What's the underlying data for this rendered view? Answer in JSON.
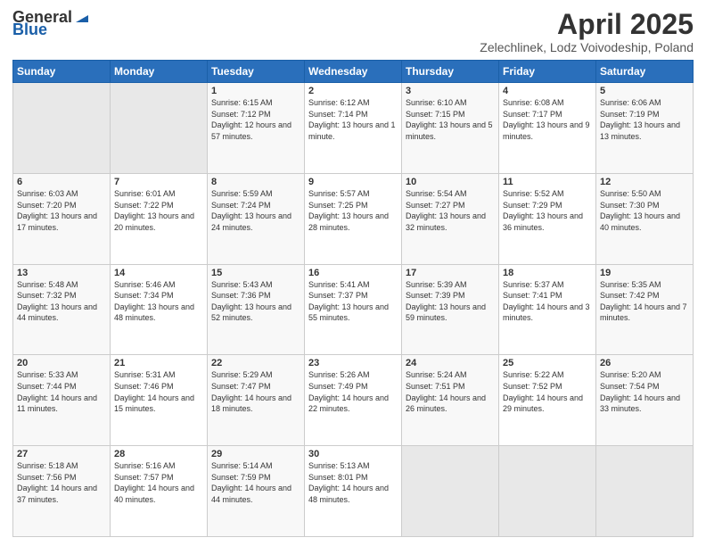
{
  "header": {
    "logo_general": "General",
    "logo_blue": "Blue",
    "month_title": "April 2025",
    "location": "Zelechlinek, Lodz Voivodeship, Poland"
  },
  "days_of_week": [
    "Sunday",
    "Monday",
    "Tuesday",
    "Wednesday",
    "Thursday",
    "Friday",
    "Saturday"
  ],
  "weeks": [
    [
      {
        "day": "",
        "sunrise": "",
        "sunset": "",
        "daylight": ""
      },
      {
        "day": "",
        "sunrise": "",
        "sunset": "",
        "daylight": ""
      },
      {
        "day": "1",
        "sunrise": "Sunrise: 6:15 AM",
        "sunset": "Sunset: 7:12 PM",
        "daylight": "Daylight: 12 hours and 57 minutes."
      },
      {
        "day": "2",
        "sunrise": "Sunrise: 6:12 AM",
        "sunset": "Sunset: 7:14 PM",
        "daylight": "Daylight: 13 hours and 1 minute."
      },
      {
        "day": "3",
        "sunrise": "Sunrise: 6:10 AM",
        "sunset": "Sunset: 7:15 PM",
        "daylight": "Daylight: 13 hours and 5 minutes."
      },
      {
        "day": "4",
        "sunrise": "Sunrise: 6:08 AM",
        "sunset": "Sunset: 7:17 PM",
        "daylight": "Daylight: 13 hours and 9 minutes."
      },
      {
        "day": "5",
        "sunrise": "Sunrise: 6:06 AM",
        "sunset": "Sunset: 7:19 PM",
        "daylight": "Daylight: 13 hours and 13 minutes."
      }
    ],
    [
      {
        "day": "6",
        "sunrise": "Sunrise: 6:03 AM",
        "sunset": "Sunset: 7:20 PM",
        "daylight": "Daylight: 13 hours and 17 minutes."
      },
      {
        "day": "7",
        "sunrise": "Sunrise: 6:01 AM",
        "sunset": "Sunset: 7:22 PM",
        "daylight": "Daylight: 13 hours and 20 minutes."
      },
      {
        "day": "8",
        "sunrise": "Sunrise: 5:59 AM",
        "sunset": "Sunset: 7:24 PM",
        "daylight": "Daylight: 13 hours and 24 minutes."
      },
      {
        "day": "9",
        "sunrise": "Sunrise: 5:57 AM",
        "sunset": "Sunset: 7:25 PM",
        "daylight": "Daylight: 13 hours and 28 minutes."
      },
      {
        "day": "10",
        "sunrise": "Sunrise: 5:54 AM",
        "sunset": "Sunset: 7:27 PM",
        "daylight": "Daylight: 13 hours and 32 minutes."
      },
      {
        "day": "11",
        "sunrise": "Sunrise: 5:52 AM",
        "sunset": "Sunset: 7:29 PM",
        "daylight": "Daylight: 13 hours and 36 minutes."
      },
      {
        "day": "12",
        "sunrise": "Sunrise: 5:50 AM",
        "sunset": "Sunset: 7:30 PM",
        "daylight": "Daylight: 13 hours and 40 minutes."
      }
    ],
    [
      {
        "day": "13",
        "sunrise": "Sunrise: 5:48 AM",
        "sunset": "Sunset: 7:32 PM",
        "daylight": "Daylight: 13 hours and 44 minutes."
      },
      {
        "day": "14",
        "sunrise": "Sunrise: 5:46 AM",
        "sunset": "Sunset: 7:34 PM",
        "daylight": "Daylight: 13 hours and 48 minutes."
      },
      {
        "day": "15",
        "sunrise": "Sunrise: 5:43 AM",
        "sunset": "Sunset: 7:36 PM",
        "daylight": "Daylight: 13 hours and 52 minutes."
      },
      {
        "day": "16",
        "sunrise": "Sunrise: 5:41 AM",
        "sunset": "Sunset: 7:37 PM",
        "daylight": "Daylight: 13 hours and 55 minutes."
      },
      {
        "day": "17",
        "sunrise": "Sunrise: 5:39 AM",
        "sunset": "Sunset: 7:39 PM",
        "daylight": "Daylight: 13 hours and 59 minutes."
      },
      {
        "day": "18",
        "sunrise": "Sunrise: 5:37 AM",
        "sunset": "Sunset: 7:41 PM",
        "daylight": "Daylight: 14 hours and 3 minutes."
      },
      {
        "day": "19",
        "sunrise": "Sunrise: 5:35 AM",
        "sunset": "Sunset: 7:42 PM",
        "daylight": "Daylight: 14 hours and 7 minutes."
      }
    ],
    [
      {
        "day": "20",
        "sunrise": "Sunrise: 5:33 AM",
        "sunset": "Sunset: 7:44 PM",
        "daylight": "Daylight: 14 hours and 11 minutes."
      },
      {
        "day": "21",
        "sunrise": "Sunrise: 5:31 AM",
        "sunset": "Sunset: 7:46 PM",
        "daylight": "Daylight: 14 hours and 15 minutes."
      },
      {
        "day": "22",
        "sunrise": "Sunrise: 5:29 AM",
        "sunset": "Sunset: 7:47 PM",
        "daylight": "Daylight: 14 hours and 18 minutes."
      },
      {
        "day": "23",
        "sunrise": "Sunrise: 5:26 AM",
        "sunset": "Sunset: 7:49 PM",
        "daylight": "Daylight: 14 hours and 22 minutes."
      },
      {
        "day": "24",
        "sunrise": "Sunrise: 5:24 AM",
        "sunset": "Sunset: 7:51 PM",
        "daylight": "Daylight: 14 hours and 26 minutes."
      },
      {
        "day": "25",
        "sunrise": "Sunrise: 5:22 AM",
        "sunset": "Sunset: 7:52 PM",
        "daylight": "Daylight: 14 hours and 29 minutes."
      },
      {
        "day": "26",
        "sunrise": "Sunrise: 5:20 AM",
        "sunset": "Sunset: 7:54 PM",
        "daylight": "Daylight: 14 hours and 33 minutes."
      }
    ],
    [
      {
        "day": "27",
        "sunrise": "Sunrise: 5:18 AM",
        "sunset": "Sunset: 7:56 PM",
        "daylight": "Daylight: 14 hours and 37 minutes."
      },
      {
        "day": "28",
        "sunrise": "Sunrise: 5:16 AM",
        "sunset": "Sunset: 7:57 PM",
        "daylight": "Daylight: 14 hours and 40 minutes."
      },
      {
        "day": "29",
        "sunrise": "Sunrise: 5:14 AM",
        "sunset": "Sunset: 7:59 PM",
        "daylight": "Daylight: 14 hours and 44 minutes."
      },
      {
        "day": "30",
        "sunrise": "Sunrise: 5:13 AM",
        "sunset": "Sunset: 8:01 PM",
        "daylight": "Daylight: 14 hours and 48 minutes."
      },
      {
        "day": "",
        "sunrise": "",
        "sunset": "",
        "daylight": ""
      },
      {
        "day": "",
        "sunrise": "",
        "sunset": "",
        "daylight": ""
      },
      {
        "day": "",
        "sunrise": "",
        "sunset": "",
        "daylight": ""
      }
    ]
  ]
}
